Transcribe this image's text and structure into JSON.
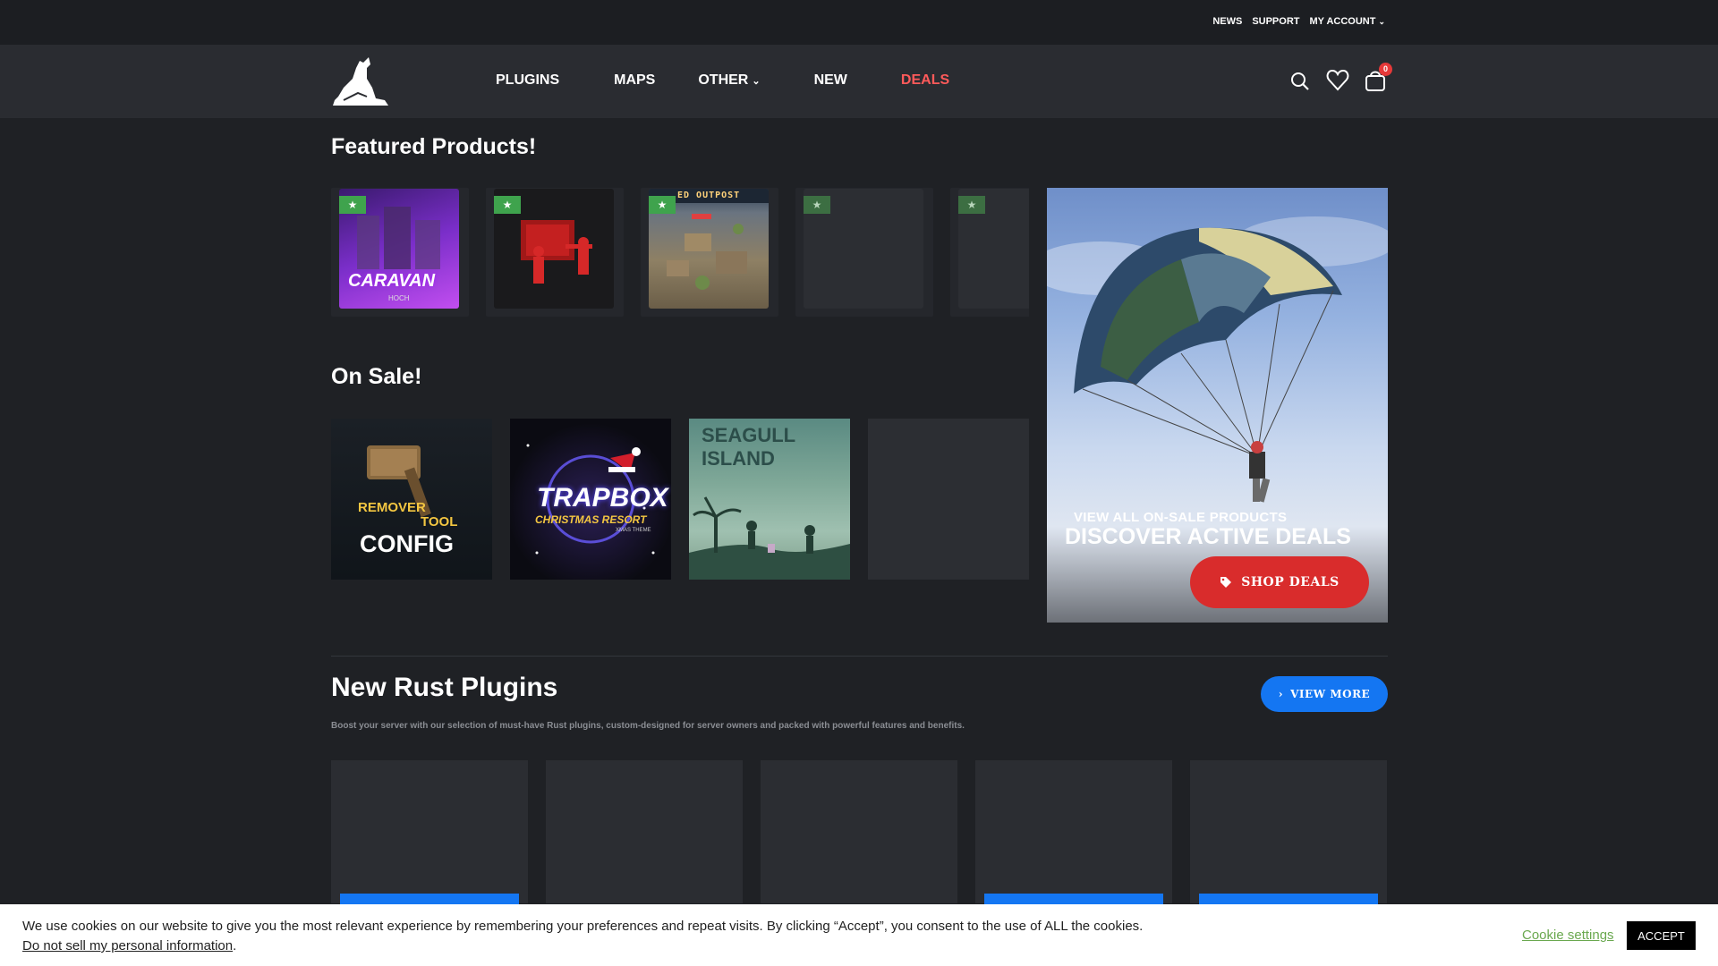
{
  "topbar": {
    "links": [
      "NEWS",
      "SUPPORT",
      "MY ACCOUNT"
    ]
  },
  "header": {
    "nav": [
      {
        "label": "PLUGINS"
      },
      {
        "label": "MAPS"
      },
      {
        "label": "OTHER"
      },
      {
        "label": "NEW"
      },
      {
        "label": "DEALS"
      }
    ],
    "cart_count": "0",
    "icons": [
      "search-icon",
      "heart-icon",
      "cart-icon"
    ]
  },
  "featured": {
    "title": "Featured Products!",
    "items": [
      {
        "name": "CARAVAN",
        "sub": "HOCH"
      },
      {
        "name": ""
      },
      {
        "name": "ED OUTPOST"
      },
      {
        "name": ""
      },
      {
        "name": ""
      }
    ]
  },
  "sale": {
    "title": "On Sale!",
    "items": [
      {
        "line1": "REMOVER",
        "line2": "TOOL",
        "line3": "CONFIG"
      },
      {
        "line1": "TRAPBOX",
        "line2": "CHRISTMAS RESORT",
        "line3": "XMAS THEME"
      },
      {
        "line1": "SEAGULL ISLAND"
      },
      {
        "line1": ""
      }
    ]
  },
  "deals_banner": {
    "small": "VIEW ALL ON-SALE PRODUCTS",
    "big": "DISCOVER ACTIVE DEALS",
    "button": "SHOP DEALS"
  },
  "plugins": {
    "title": "New Rust Plugins",
    "view_more": "VIEW MORE",
    "description": "Boost your server with our selection of must-have Rust plugins, custom-designed for server owners and packed with powerful features and benefits."
  },
  "cookie": {
    "message": "We use cookies on our website to give you the most relevant experience by remembering your preferences and repeat visits. By clicking “Accept”, you consent to the use of ALL the cookies.",
    "dns_link": "Do not sell my personal information",
    "settings": "Cookie settings",
    "accept": "ACCEPT"
  },
  "colors": {
    "accent_blue": "#1476f2",
    "deals_red": "#d92c2c",
    "badge_green": "#3fa34d",
    "bg": "#1f2125"
  }
}
